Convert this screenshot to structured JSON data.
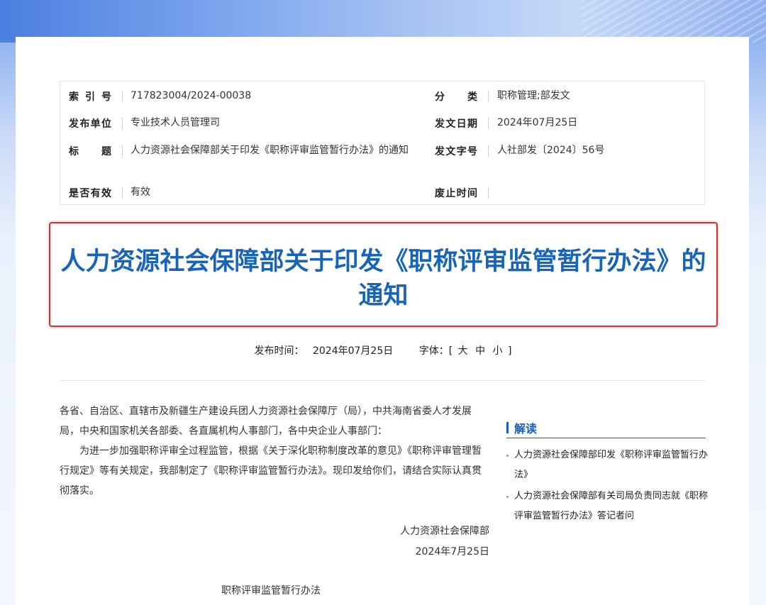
{
  "meta": {
    "index_label": "索 引 号",
    "index_value": "717823004/2024-00038",
    "category_label": "分 类",
    "category_value": "职称管理;部发文",
    "publisher_label": "发布单位",
    "publisher_value": "专业技术人员管理司",
    "issue_date_label": "发文日期",
    "issue_date_value": "2024年07月25日",
    "title_label": "标 题",
    "title_value": "人力资源社会保障部关于印发《职称评审监管暂行办法》的通知",
    "doc_no_label": "发文字号",
    "doc_no_value": "人社部发〔2024〕56号",
    "valid_label": "是否有效",
    "valid_value": "有效",
    "expire_label": "废止时间",
    "expire_value": ""
  },
  "article": {
    "title": "人力资源社会保障部关于印发《职称评审监管暂行办法》的通知",
    "pub_label": "发布时间：",
    "pub_date": "2024年07月25日",
    "font_label": "字体：[",
    "font_large": "大",
    "font_medium": "中",
    "font_small": "小",
    "font_close": "]",
    "recipients": "各省、自治区、直辖市及新疆生产建设兵团人力资源社会保障厅（局），中共海南省委人才发展局，中央和国家机关各部委、各直属机构人事部门，各中央企业人事部门：",
    "body": "为进一步加强职称评审全过程监管，根据《关于深化职称制度改革的意见》《职称评审管理暂行规定》等有关规定，我部制定了《职称评审监管暂行办法》。现印发给你们，请结合实际认真贯彻落实。",
    "signature": "人力资源社会保障部",
    "sign_date": "2024年7月25日",
    "attachment_title": "职称评审监管暂行办法"
  },
  "sidebar": {
    "heading": "解读",
    "items": [
      "人力资源社会保障部印发《职称评审监管暂行办法》",
      "人力资源社会保障部有关司局负责同志就《职称评审监管暂行办法》答记者问"
    ]
  },
  "colors": {
    "title_blue": "#1764b8",
    "highlight_red": "#e12b2b",
    "accent_blue": "#1a5fb4"
  }
}
